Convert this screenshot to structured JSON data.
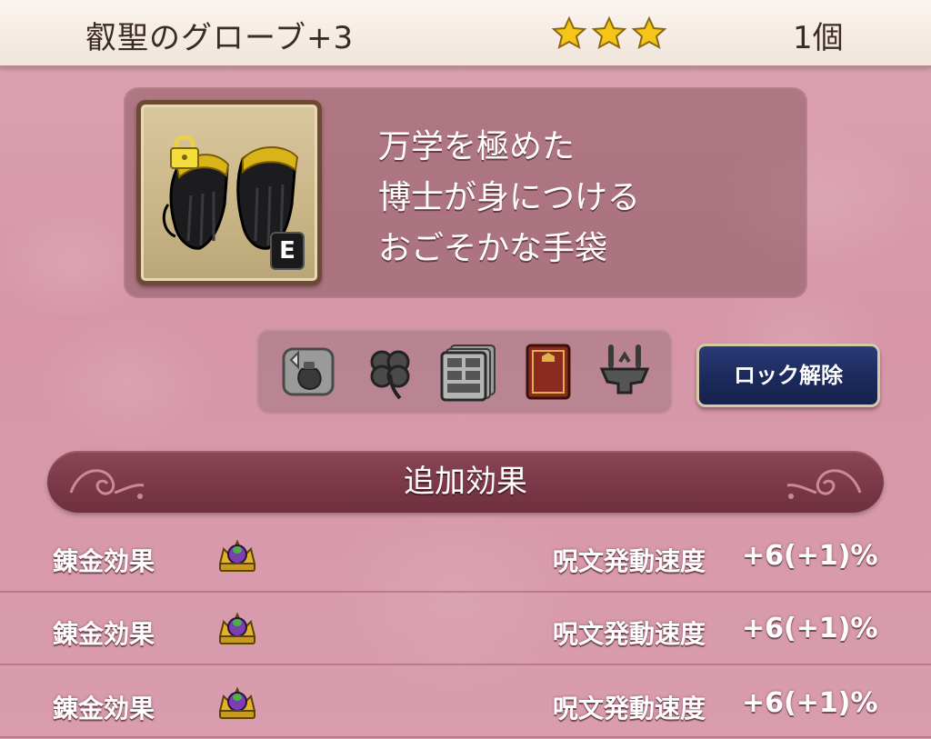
{
  "header": {
    "item_name": "叡聖のグローブ+3",
    "star_count": 3,
    "star_color": "#f5c518",
    "quantity": "1個"
  },
  "item": {
    "icon": "black-gloves-icon",
    "locked_badge": "lock-icon",
    "equipped_badge": "E",
    "description": [
      "万学を極めた",
      "博士が身につける",
      "おごそかな手袋"
    ]
  },
  "actions": {
    "icons": [
      "sell-bag-icon",
      "clover-icon",
      "storage-drawer-icon",
      "book-icon",
      "upgrade-anvil-icon"
    ],
    "unlock_label": "ロック解除",
    "unlock_color": "#1b2a5c"
  },
  "effects": {
    "section_title": "追加効果",
    "rows": [
      {
        "label": "錬金効果",
        "icon": "crown-gem-icon",
        "stat": "呪文発動速度",
        "value": "+6(+1)%"
      },
      {
        "label": "錬金効果",
        "icon": "crown-gem-icon",
        "stat": "呪文発動速度",
        "value": "+6(+1)%"
      },
      {
        "label": "錬金効果",
        "icon": "crown-gem-icon",
        "stat": "呪文発動速度",
        "value": "+6(+1)%"
      }
    ]
  }
}
